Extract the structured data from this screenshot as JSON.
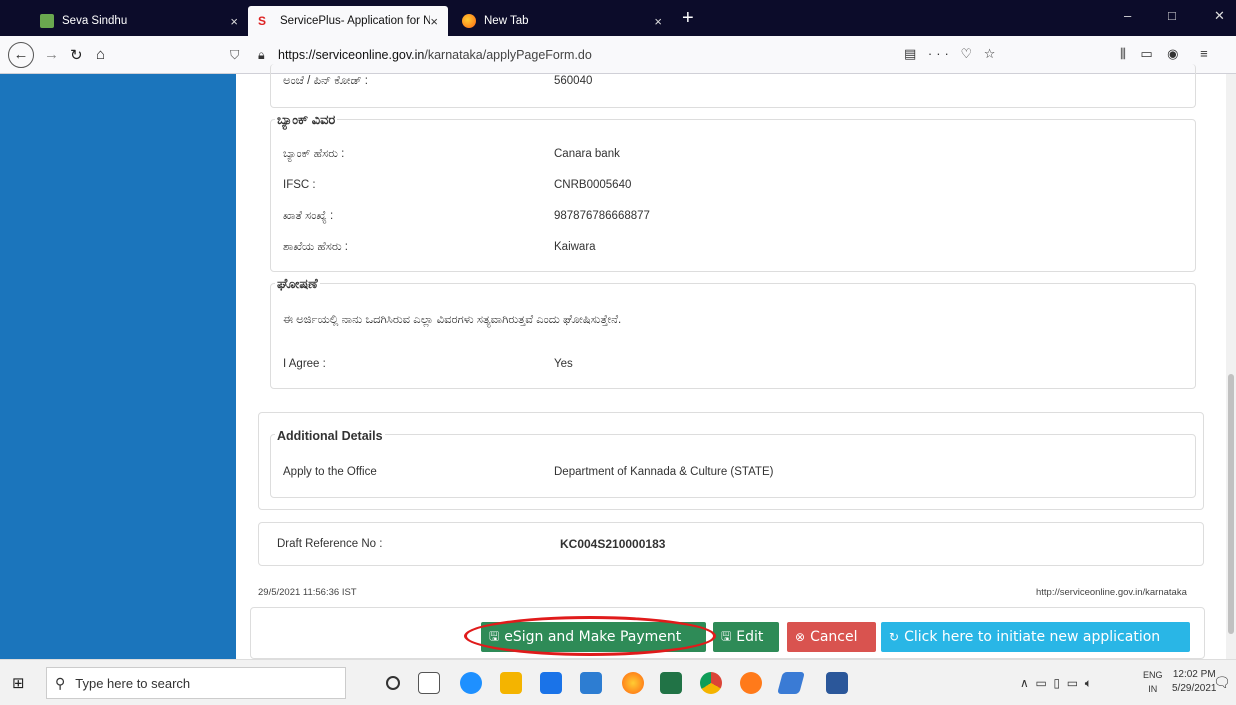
{
  "browser": {
    "tabs": [
      {
        "title": "Seva Sindhu",
        "favicon": "seva-sindhu-icon"
      },
      {
        "title": "ServicePlus- Application for Na",
        "favicon": "serviceplus-icon"
      },
      {
        "title": "New Tab",
        "favicon": "firefox-icon"
      }
    ],
    "tab_close": "×",
    "new_tab": "+",
    "url_scheme_host": "https://serviceonline.gov.in",
    "url_path": "/karnataka/applyPageForm.do",
    "window_controls": [
      "–",
      "□",
      "✕"
    ]
  },
  "form": {
    "pincode_label": "ಅಂಚೆ / ಪಿನ್ ಕೋಡ್ :",
    "pincode_value": "560040",
    "bank_section_title": "ಬ್ಯಾಂಕ್ ವಿವರ",
    "bank_fields": [
      {
        "label": "ಬ್ಯಾಂಕ್ ಹೆಸರು :",
        "value": "Canara bank"
      },
      {
        "label": "IFSC :",
        "value": "CNRB0005640"
      },
      {
        "label": "ಖಾತೆ ಸಂಖ್ಯೆ :",
        "value": "987876786668877"
      },
      {
        "label": "ಶಾಖೆಯ ಹೆಸರು :",
        "value": "Kaiwara"
      }
    ],
    "declaration_title": "ಘೋಷಣೆ",
    "declaration_text": "ಈ ಅರ್ಜಿಯಲ್ಲಿ ನಾನು ಒದಗಿಸಿರುವ ಎಲ್ಲಾ ವಿವರಗಳು ಸತ್ಯವಾಗಿರುತ್ತವೆ ಎಂದು ಘೋಷಿಸುತ್ತೇನೆ.",
    "agree_label": "I Agree :",
    "agree_value": "Yes",
    "additional_title": "Additional Details",
    "office_label": "Apply to the Office",
    "office_value": "Department of Kannada & Culture (STATE)",
    "draft_label": "Draft Reference No :",
    "draft_value": "KC004S210000183",
    "timestamp": "29/5/2021 11:56:36 IST",
    "site_url": "http://serviceonline.gov.in/karnataka"
  },
  "buttons": {
    "esign": "eSign and Make Payment",
    "edit": "Edit",
    "cancel": "Cancel",
    "new_application": "Click here to initiate new application"
  },
  "taskbar": {
    "search_placeholder": "Type here to search",
    "lang_top": "ENG",
    "lang_bottom": "IN",
    "time": "12:02 PM",
    "date": "5/29/2021"
  },
  "colors": {
    "sidebar": "#1b75bc",
    "green_button": "#2e8b57",
    "cancel_button": "#d9534f",
    "info_button": "#29b6e6",
    "highlight_oval": "#e01b1b"
  }
}
